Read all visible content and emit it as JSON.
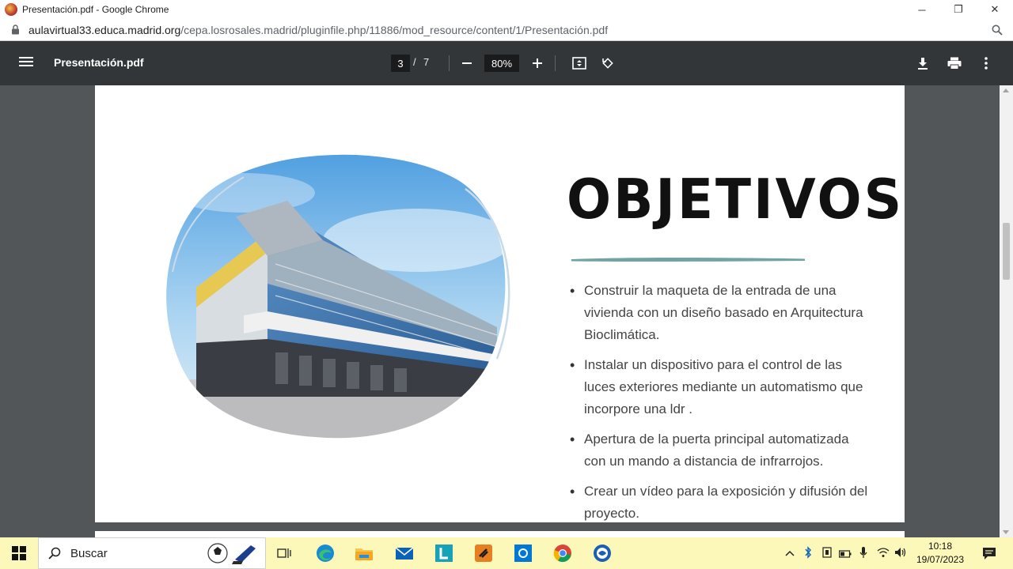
{
  "window": {
    "title": "Presentación.pdf - Google Chrome",
    "controls": [
      "─",
      "❐",
      "✕"
    ]
  },
  "address": {
    "host": "aulavirtual33.educa.madrid.org",
    "path": "/cepa.losrosales.madrid/pluginfile.php/11886/mod_resource/content/1/Presentación.pdf"
  },
  "pdf_toolbar": {
    "doc_title": "Presentación.pdf",
    "current_page": "3",
    "page_separator": "/",
    "total_pages": "7",
    "zoom": "80%"
  },
  "slide": {
    "heading": "OBJETIVOS",
    "accent_color": "#6fa3a6",
    "bullets": [
      "Construir la maqueta de la entrada de una vivienda con un diseño basado en Arquitectura Bioclimática.",
      "Instalar un dispositivo para el control de las luces exteriores mediante un automatismo  que incorpore una ldr .",
      "Apertura de la puerta principal automatizada con un mando a distancia de infrarrojos.",
      "Crear un vídeo para la exposición y difusión del proyecto."
    ]
  },
  "taskbar": {
    "search_placeholder": "Buscar",
    "time": "10:18",
    "date": "19/07/2023"
  }
}
